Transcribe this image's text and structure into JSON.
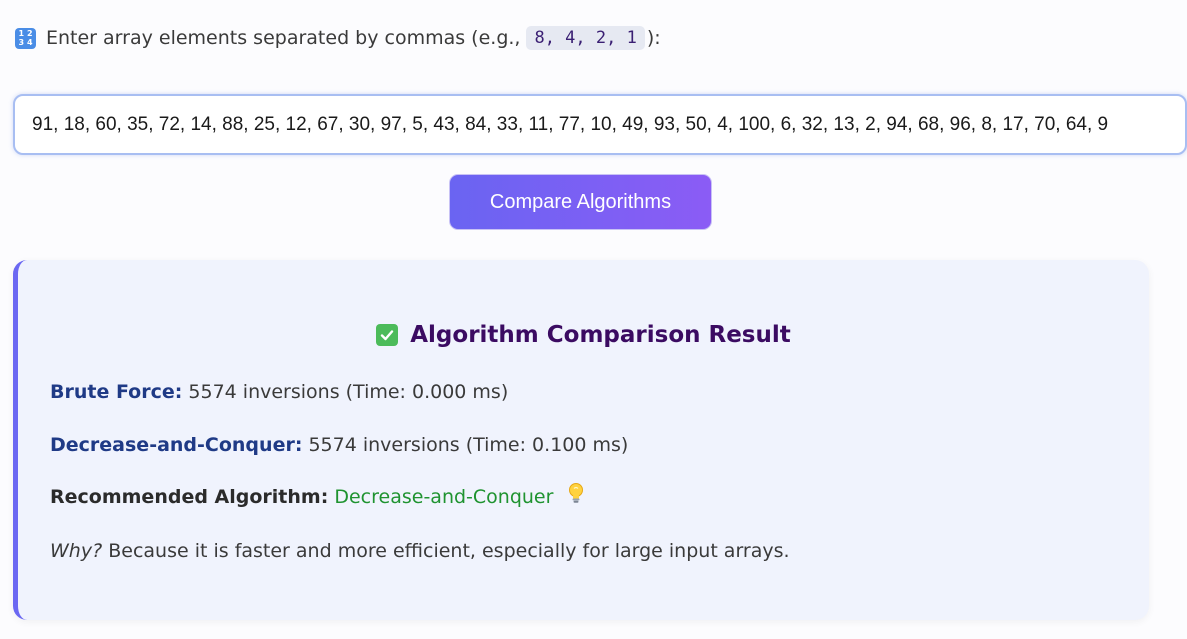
{
  "prompt": {
    "icon": "input-numbers-icon",
    "icon_digits": [
      "1",
      "2",
      "3",
      "4"
    ],
    "text_before": "Enter array elements separated by commas (e.g.,",
    "example": "8, 4, 2, 1",
    "text_after": "):"
  },
  "array_input": {
    "value": "91, 18, 60, 35, 72, 14, 88, 25, 12, 67, 30, 97, 5, 43, 84, 33, 11, 77, 10, 49, 93, 50, 4, 100, 6, 32, 13, 2, 94, 68, 96, 8, 17, 70, 64, 9"
  },
  "compare_button": {
    "label": "Compare Algorithms"
  },
  "result": {
    "title": "Algorithm Comparison Result",
    "title_icon": "check-mark-icon",
    "brute_force": {
      "label": "Brute Force:",
      "value": "5574 inversions (Time: 0.000 ms)"
    },
    "decrease_conquer": {
      "label": "Decrease-and-Conquer:",
      "value": "5574 inversions (Time: 0.100 ms)"
    },
    "recommended": {
      "label": "Recommended Algorithm:",
      "value": "Decrease-and-Conquer",
      "icon": "lightbulb-icon"
    },
    "why": {
      "label": "Why?",
      "text": "Because it is faster and more efficient, especially for large input arrays."
    }
  },
  "colors": {
    "accent": "#6b68f2",
    "button_gradient_start": "#6a64f2",
    "button_gradient_end": "#8b5cf5",
    "title": "#3b0b62",
    "key": "#1f3a86",
    "recommended": "#1f9330",
    "card_bg": "#f0f3fd"
  }
}
